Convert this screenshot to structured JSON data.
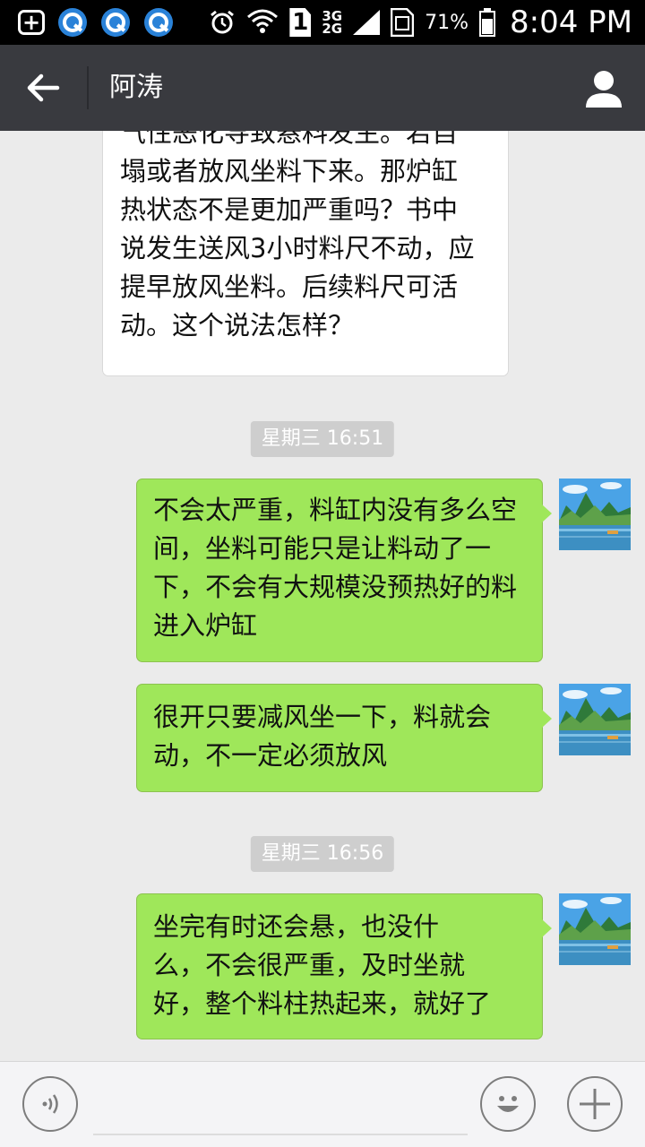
{
  "status_bar": {
    "badge_icon": "plus-box-icon",
    "notification_icons": [
      "qq-icon",
      "qq-icon",
      "qq-icon"
    ],
    "sim_label": "1",
    "network_top": "3G",
    "network_bottom": "2G",
    "battery_percent": "71%",
    "time": "8:04 PM"
  },
  "header": {
    "back_icon": "back-arrow-icon",
    "title": "阿涛",
    "profile_icon": "person-icon",
    "background_color": "#393a3f"
  },
  "messages": [
    {
      "direction": "incoming",
      "lines": [
        "气性恶化导致悬料发生。若自",
        "塌或者放风坐料下来。那炉缸",
        "热状态不是更加严重吗？书中",
        "说发生送风3小时料尺不动，应",
        "提早放风坐料。后续料尺可活",
        "动。这个说法怎样？"
      ]
    },
    {
      "type": "time",
      "text": "星期三 16:51"
    },
    {
      "direction": "outgoing",
      "lines": [
        "不会太严重，料缸内没有多么空",
        "间，坐料可能只是让料动了一",
        "下，不会有大规模没预热好的料",
        "进入炉缸"
      ]
    },
    {
      "direction": "outgoing",
      "lines": [
        "很开只要减风坐一下，料就会",
        "动，不一定必须放风"
      ]
    },
    {
      "type": "time",
      "text": "星期三 16:56"
    },
    {
      "direction": "outgoing",
      "lines": [
        "坐完有时还会悬，也没什",
        "么，不会很严重，及时坐就",
        "好，整个料柱热起来，就好了"
      ]
    }
  ],
  "input_bar": {
    "voice_icon": "voice-icon",
    "emoji_icon": "smiley-icon",
    "more_icon": "plus-icon",
    "placeholder": ""
  },
  "colors": {
    "outgoing_bubble": "#9fe75a",
    "incoming_bubble": "#ffffff",
    "chat_background": "#ebebeb"
  }
}
